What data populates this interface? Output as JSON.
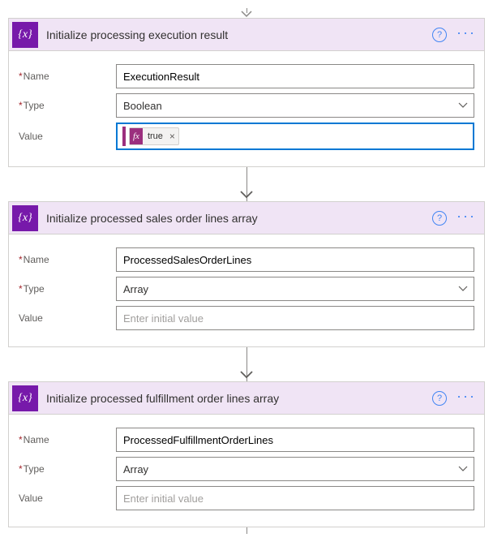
{
  "accent_purple": "#7719aa",
  "token_magenta": "#9b2f7e",
  "blue": "#0078d4",
  "link_blue": "#4285f4",
  "icon_glyph": "{x}",
  "fx_glyph": "fx",
  "labels": {
    "name": "Name",
    "type": "Type",
    "value": "Value"
  },
  "placeholders": {
    "initial_value": "Enter initial value"
  },
  "cards": [
    {
      "title": "Initialize processing execution result",
      "name_value": "ExecutionResult",
      "type_value": "Boolean",
      "value_kind": "expression",
      "value_token": "true"
    },
    {
      "title": "Initialize processed sales order lines array",
      "name_value": "ProcessedSalesOrderLines",
      "type_value": "Array",
      "value_kind": "empty"
    },
    {
      "title": "Initialize processed fulfillment order lines array",
      "name_value": "ProcessedFulfillmentOrderLines",
      "type_value": "Array",
      "value_kind": "empty"
    }
  ]
}
